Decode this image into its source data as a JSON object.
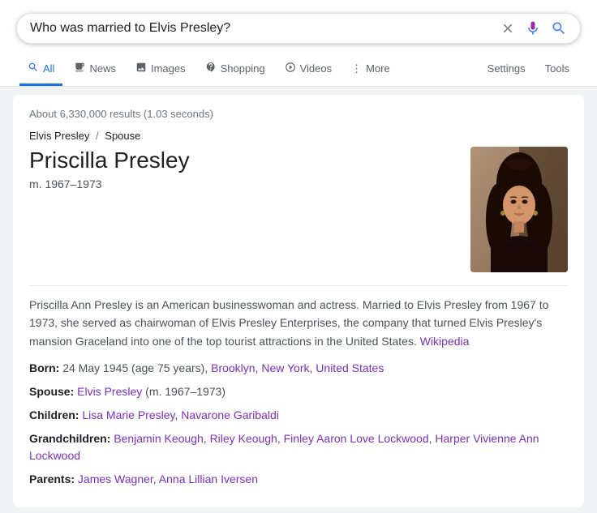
{
  "searchbar": {
    "query": "Who was married to Elvis Presley?",
    "clear_label": "✕",
    "mic_label": "🎤",
    "search_label": "🔍"
  },
  "tabs": [
    {
      "id": "all",
      "label": "All",
      "icon": "🔍",
      "active": true
    },
    {
      "id": "news",
      "label": "News",
      "icon": "📰",
      "active": false
    },
    {
      "id": "images",
      "label": "Images",
      "icon": "🖼",
      "active": false
    },
    {
      "id": "shopping",
      "label": "Shopping",
      "icon": "💎",
      "active": false
    },
    {
      "id": "videos",
      "label": "Videos",
      "icon": "▶",
      "active": false
    },
    {
      "id": "more",
      "label": "More",
      "icon": "⋮",
      "active": false
    }
  ],
  "right_tabs": [
    {
      "id": "settings",
      "label": "Settings"
    },
    {
      "id": "tools",
      "label": "Tools"
    }
  ],
  "results": {
    "count_text": "About 6,330,000 results (1.03 seconds)"
  },
  "person": {
    "breadcrumb_parent": "Elvis Presley",
    "breadcrumb_separator": "/",
    "breadcrumb_child": "Spouse",
    "name": "Priscilla Presley",
    "married_dates": "m. 1967–1973",
    "description": "Priscilla Ann Presley is an American businesswoman and actress. Married to Elvis Presley from 1967 to 1973, she served as chairwoman of Elvis Presley Enterprises, the company that turned Elvis Presley's mansion Graceland into one of the top tourist attractions in the United States.",
    "wikipedia_link_text": "Wikipedia",
    "facts": [
      {
        "label": "Born:",
        "text": "24 May 1945 (age 75 years), ",
        "links": [
          {
            "text": "Brooklyn",
            "href": "#"
          },
          {
            "text": ", New York",
            "href": "#"
          },
          {
            "text": ", United States",
            "href": "#"
          }
        ]
      },
      {
        "label": "Spouse:",
        "links": [
          {
            "text": "Elvis Presley",
            "href": "#"
          }
        ],
        "trailing_text": " (m. 1967–1973)"
      },
      {
        "label": "Children:",
        "links": [
          {
            "text": "Lisa Marie Presley",
            "href": "#"
          },
          {
            "text": "Navarone Garibaldi",
            "href": "#"
          }
        ]
      },
      {
        "label": "Grandchildren:",
        "links": [
          {
            "text": "Benjamin Keough",
            "href": "#"
          },
          {
            "text": "Riley Keough",
            "href": "#"
          },
          {
            "text": "Finley Aaron Love Lockwood",
            "href": "#"
          },
          {
            "text": "Harper Vivienne Ann Lockwood",
            "href": "#"
          }
        ]
      },
      {
        "label": "Parents:",
        "links": [
          {
            "text": "James Wagner",
            "href": "#"
          },
          {
            "text": "Anna Lillian Iversen",
            "href": "#"
          }
        ]
      }
    ]
  }
}
